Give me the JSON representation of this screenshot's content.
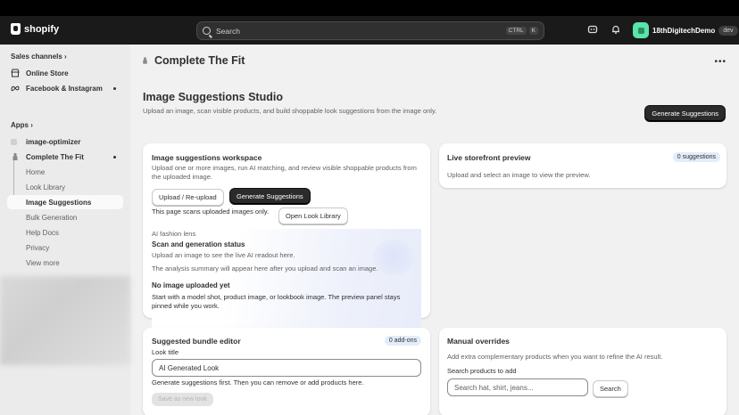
{
  "topbar": {
    "brand": "shopify",
    "search_placeholder": "Search",
    "kbd_ctrl": "CTRL",
    "kbd_k": "K",
    "user_name": "18thDigitechDemo",
    "user_badge": "dev"
  },
  "sidebar": {
    "sales_channels_label": "Sales channels",
    "online_store": "Online Store",
    "facebook_instagram": "Facebook & Instagram",
    "apps_label": "Apps",
    "image_optimizer": "image-optimizer",
    "complete_the_fit": "Complete The Fit",
    "sub_items": [
      "Home",
      "Look Library",
      "Image Suggestions",
      "Bulk Generation",
      "Help Docs",
      "Privacy",
      "View more"
    ]
  },
  "page": {
    "title": "Complete The Fit",
    "studio_title": "Image Suggestions Studio",
    "studio_subtitle": "Upload an image, scan visible products, and build shoppable look suggestions from the image only.",
    "generate_button": "Generate Suggestions"
  },
  "workspace": {
    "title": "Image suggestions workspace",
    "description": "Upload one or more images, run AI matching, and review visible shoppable products from the uploaded image.",
    "upload_button": "Upload / Re-upload",
    "generate_button": "Generate Suggestions",
    "scan_note": "This page scans uploaded images only.",
    "open_library_button": "Open Look Library",
    "lens_label": "AI fashion lens",
    "status_title": "Scan and generation status",
    "status_text": "Upload an image to see the live AI readout here.",
    "analysis_text": "The analysis summary will appear here after you upload and scan an image.",
    "no_image_title": "No image uploaded yet",
    "no_image_text": "Start with a model shot, product image, or lookbook image. The preview panel stays pinned while you work."
  },
  "preview": {
    "title": "Live storefront preview",
    "badge": "0 suggestions",
    "text": "Upload and select an image to view the preview."
  },
  "bundle": {
    "title": "Suggested bundle editor",
    "badge": "0 add-ons",
    "look_title_label": "Look title",
    "look_title_value": "AI Generated Look",
    "help_text": "Generate suggestions first. Then you can remove or add products here.",
    "save_button": "Save as new look"
  },
  "overrides": {
    "title": "Manual overrides",
    "text": "Add extra complementary products when you want to refine the AI result.",
    "search_label": "Search products to add",
    "search_placeholder": "Search hat, shirt, jeans...",
    "search_button": "Search"
  },
  "colors": {
    "topbar_bg": "#1a1a1a",
    "page_bg": "#f1f1f1",
    "primary_button": "#2b2b2b",
    "avatar": "#59e4a8",
    "badge_bg": "#e3ecfa"
  }
}
